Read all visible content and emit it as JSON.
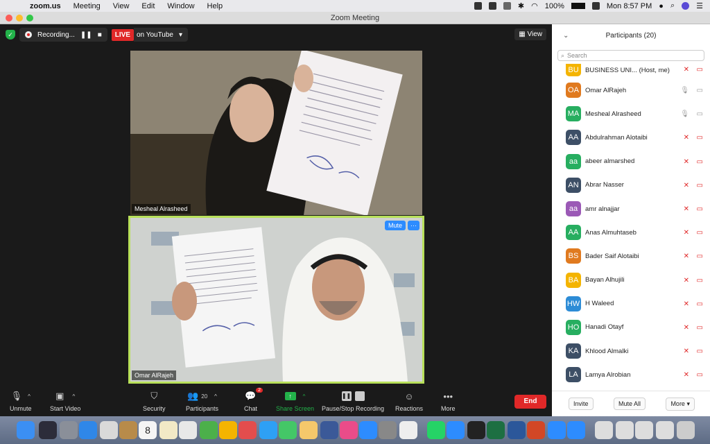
{
  "menubar": {
    "app": "zoom.us",
    "items": [
      "Meeting",
      "View",
      "Edit",
      "Window",
      "Help"
    ],
    "battery": "100%",
    "clock": "Mon 8:57 PM"
  },
  "window": {
    "title": "Zoom Meeting"
  },
  "topbar": {
    "recording": "Recording...",
    "live": "LIVE",
    "live_dest": "on YouTube",
    "view": "View"
  },
  "tiles": [
    {
      "name": "Mesheal Alrasheed"
    },
    {
      "name": "Omar AlRajeh",
      "mute": "Mute",
      "more": "···"
    }
  ],
  "toolbar": {
    "unmute": "Unmute",
    "start_video": "Start Video",
    "security": "Security",
    "participants": "Participants",
    "participants_count": "20",
    "chat": "Chat",
    "chat_badge": "2",
    "share": "Share Screen",
    "record": "Pause/Stop Recording",
    "reactions": "Reactions",
    "more": "More",
    "end": "End"
  },
  "panel": {
    "title": "Participants (20)",
    "search_placeholder": "Search",
    "participants": [
      {
        "initials": "BU",
        "name": "BUSINESS UNI... (Host, me)",
        "color": "#f4b400"
      },
      {
        "initials": "OA",
        "name": "Omar AlRajeh",
        "color": "#e07a1f"
      },
      {
        "initials": "MA",
        "name": "Mesheal Alrasheed",
        "color": "#27ae60"
      },
      {
        "initials": "AA",
        "name": "Abdulrahman Alotaibi",
        "color": "#3d4f66"
      },
      {
        "initials": "aa",
        "name": "abeer almarshed",
        "color": "#27ae60"
      },
      {
        "initials": "AN",
        "name": "Abrar Nasser",
        "color": "#3d4f66"
      },
      {
        "initials": "aa",
        "name": "amr alnajjar",
        "color": "#9b59b6"
      },
      {
        "initials": "AA",
        "name": "Anas Almuhtaseb",
        "color": "#27ae60"
      },
      {
        "initials": "BS",
        "name": "Bader Saif Alotaibi",
        "color": "#e07a1f"
      },
      {
        "initials": "BA",
        "name": "Bayan Alhujili",
        "color": "#f4b400"
      },
      {
        "initials": "HW",
        "name": "H Waleed",
        "color": "#2d8cd6"
      },
      {
        "initials": "HO",
        "name": "Hanadi Otayf",
        "color": "#27ae60"
      },
      {
        "initials": "KA",
        "name": "Khlood Almalki",
        "color": "#3d4f66"
      },
      {
        "initials": "LA",
        "name": "Lamya Alrobian",
        "color": "#3d4f66"
      }
    ],
    "invite": "Invite",
    "mute_all": "Mute All",
    "more": "More"
  },
  "dock": {
    "calendar_day": "8"
  }
}
